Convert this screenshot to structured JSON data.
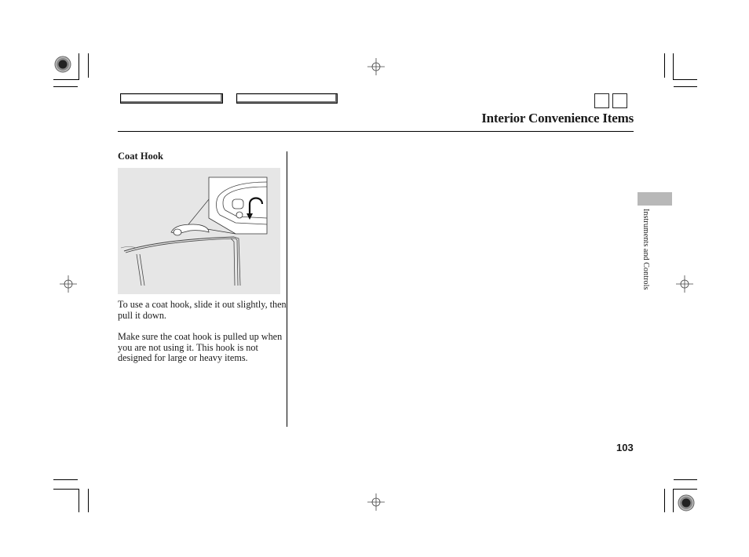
{
  "header": {
    "nav_buttons": [
      {
        "name": "main-menu-button",
        "label": ""
      },
      {
        "name": "table-of-contents-button",
        "label": ""
      }
    ],
    "page_nav_squares": [
      {
        "name": "previous-page-button",
        "label": ""
      },
      {
        "name": "next-page-button",
        "label": ""
      }
    ],
    "title": "Interior Convenience Items"
  },
  "section": {
    "heading": "Coat Hook",
    "figure_alt": "Illustration of a coat hook above a rear car door, with a magnified inset showing the hook sliding out and pulling down (arrow).",
    "paragraphs": [
      "To use a coat hook, slide it out slightly, then pull it down.",
      "Make sure the coat hook is pulled up when you are not using it. This hook is not designed for large or heavy items."
    ]
  },
  "side_tab": {
    "label": "Instruments and Controls",
    "color": "#b8b8b8"
  },
  "footer": {
    "page_number": "103"
  },
  "print_marks": {
    "registration": [
      "top-left",
      "bottom-right"
    ],
    "crosshairs": [
      "top-center",
      "bottom-center",
      "left-middle",
      "right-middle"
    ]
  }
}
